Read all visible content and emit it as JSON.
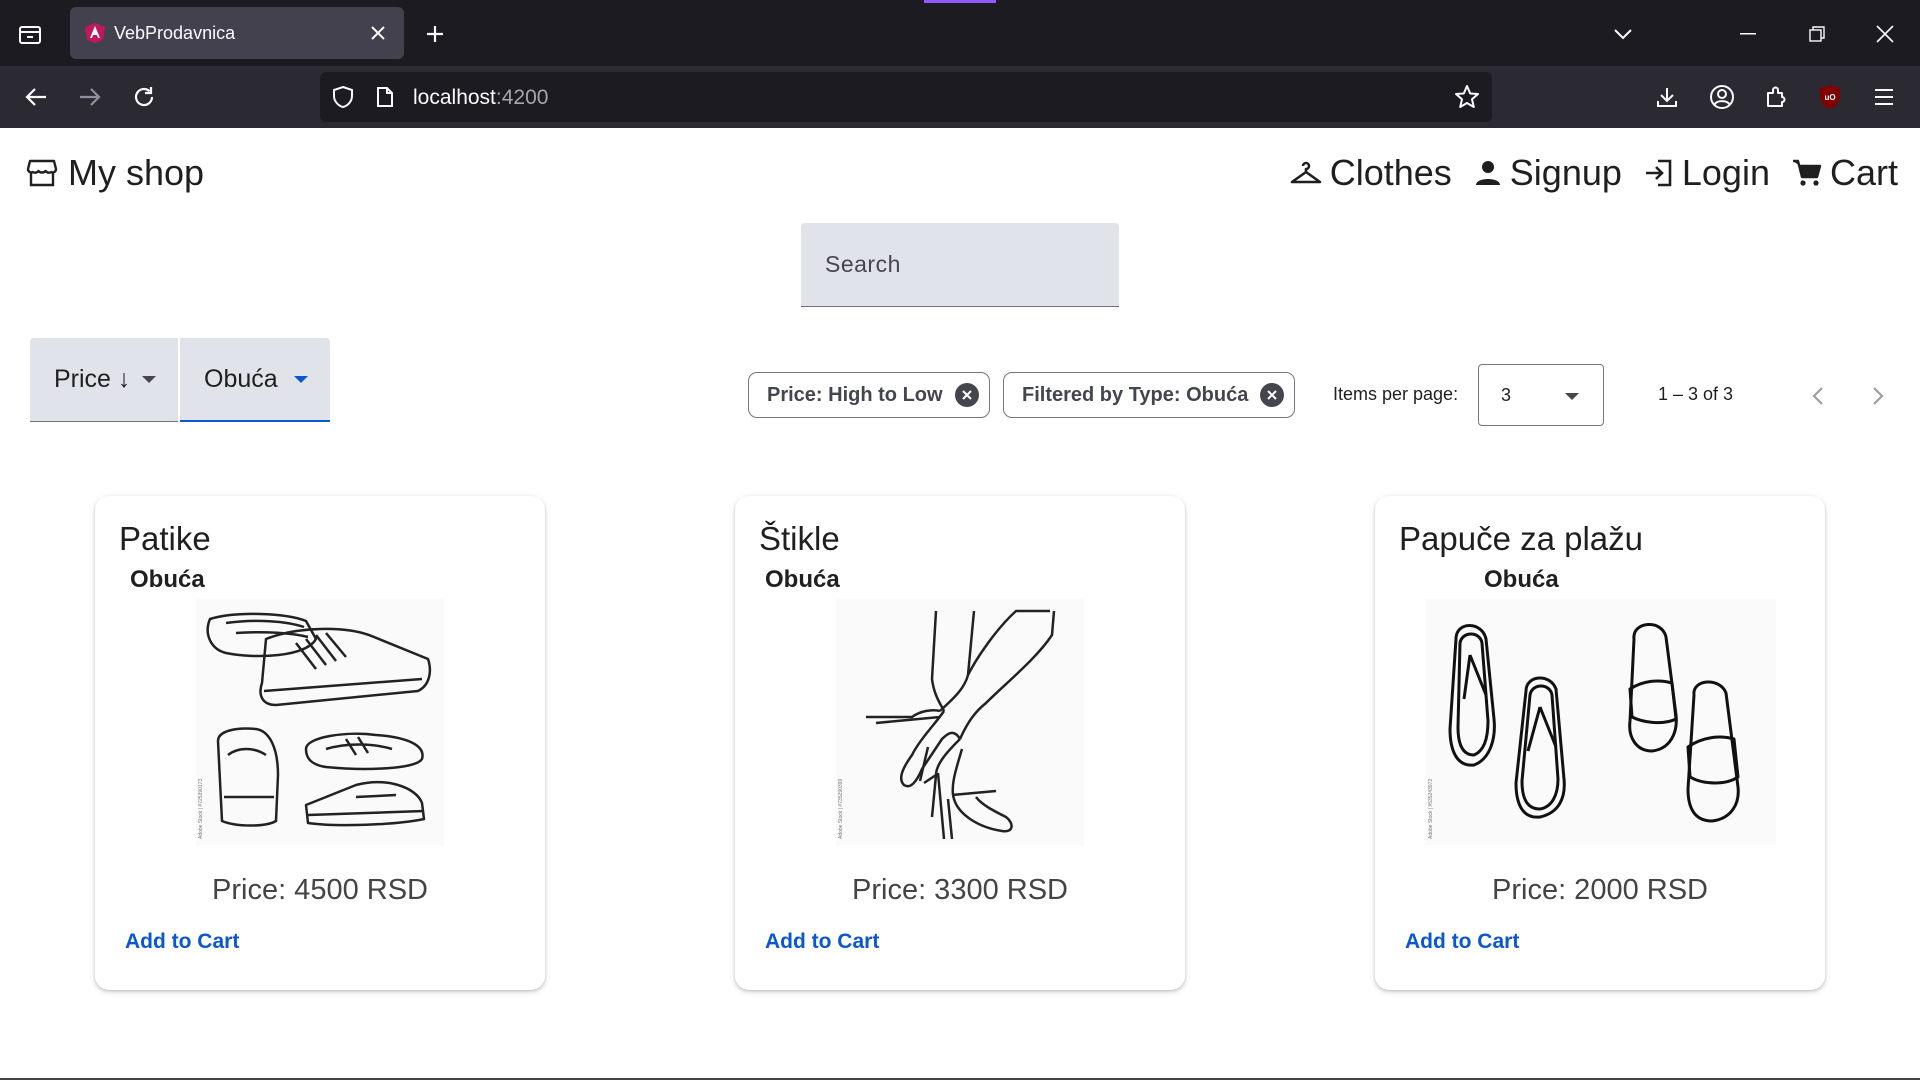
{
  "browser": {
    "tab_title": "VebProdavnica",
    "url_host": "localhost",
    "url_port": ":4200"
  },
  "header": {
    "brand": "My shop",
    "nav": [
      "Clothes",
      "Signup",
      "Login",
      "Cart"
    ]
  },
  "search": {
    "placeholder": "Search"
  },
  "filters": {
    "sort_label": "Price ↓",
    "type_label": "Obuća"
  },
  "chips": [
    "Price: High to Low",
    "Filtered by Type: Obuća"
  ],
  "paginator": {
    "items_per_page_label": "Items per page:",
    "items_per_page_value": "3",
    "range": "1 – 3 of 3"
  },
  "products": [
    {
      "name": "Patike",
      "type": "Obuća",
      "price": "Price: 4500 RSD",
      "action": "Add to Cart"
    },
    {
      "name": "Štikle",
      "type": "Obuća",
      "price": "Price: 3300 RSD",
      "action": "Add to Cart"
    },
    {
      "name": "Papuče za plažu",
      "type": "Obuća",
      "price": "Price: 2000 RSD",
      "action": "Add to Cart"
    }
  ],
  "colors": {
    "primary": "#0b57d0",
    "chrome_dark": "#1c1b22",
    "accent": "#9059ff"
  }
}
